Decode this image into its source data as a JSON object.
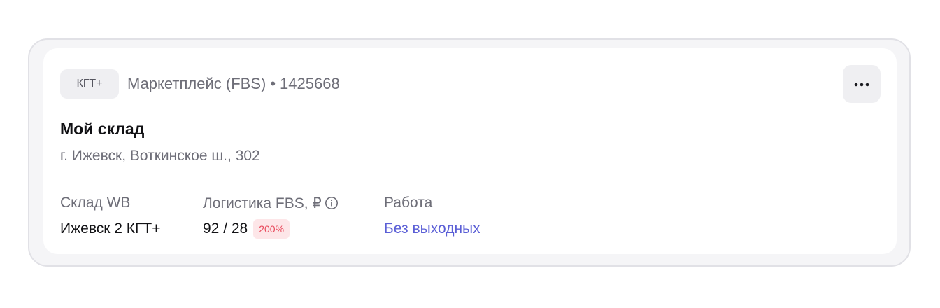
{
  "warehouse": {
    "tag": "КГТ+",
    "type": "Маркетплейс (FBS)",
    "separator": "•",
    "id": "1425668",
    "title": "Мой склад",
    "address": "г. Ижевск, Воткинское ш., 302"
  },
  "columns": {
    "wb_label": "Склад WB",
    "wb_value": "Ижевск 2 КГТ+",
    "logistics_label": "Логистика FBS, ₽",
    "logistics_value": "92 / 28",
    "logistics_badge": "200%",
    "work_label": "Работа",
    "work_value": "Без выходных"
  },
  "icons": {
    "menu": "more-dots-icon",
    "info": "info-icon"
  },
  "colors": {
    "accent_link": "#5b5fd6",
    "badge_bg": "#fde6e8",
    "badge_text": "#e8485a"
  }
}
